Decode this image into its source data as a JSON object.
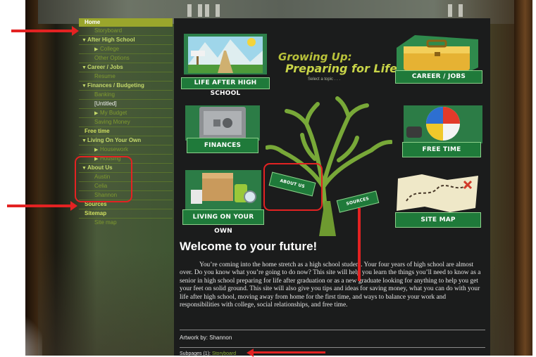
{
  "sidebar": {
    "items": [
      {
        "label": "Home"
      },
      {
        "label": "Storyboard"
      },
      {
        "label": "After High School"
      },
      {
        "label": "College"
      },
      {
        "label": "Other Options"
      },
      {
        "label": "Career / Jobs"
      },
      {
        "label": "Resume"
      },
      {
        "label": "Finances / Budgeting"
      },
      {
        "label": "Banking"
      },
      {
        "label": "[Untitled]"
      },
      {
        "label": "My Budget"
      },
      {
        "label": "Saving Money"
      },
      {
        "label": "Free time"
      },
      {
        "label": "Living On Your Own"
      },
      {
        "label": "Housework"
      },
      {
        "label": "Housing"
      },
      {
        "label": "About Us"
      },
      {
        "label": "Austin"
      },
      {
        "label": "Celia"
      },
      {
        "label": "Shannon"
      },
      {
        "label": "Sources"
      },
      {
        "label": "Sitemap"
      },
      {
        "label": "Site map"
      }
    ]
  },
  "main": {
    "title_line1": "Growing Up:",
    "title_line2": "Preparing for Life",
    "title_line3": "Select a topic . . .",
    "tiles": {
      "life_after": "LIFE AFTER HIGH SCHOOL",
      "career": "CAREER / JOBS",
      "finances": "FINANCES",
      "free_time": "FREE TIME",
      "living": "LIVING ON YOUR OWN",
      "site_map": "SITE MAP",
      "about_us": "ABOUT US",
      "sources": "SOURCES"
    },
    "welcome": "Welcome to your future!",
    "body": "You’re coming into the home stretch as a high school student. Your four years of high school are almost over. Do you know what you’re going to do now? This site will help you learn the things you’ll need to know as a senior in high school preparing for life after graduation or as a new graduate looking for anything to help you get your feet on solid ground. This site will also give you tips and ideas for saving money, what you can do with your life after high school, moving away from home for the first time, and ways to balance your work and responsibilities with college, social relationships, and free time.",
    "artwork": "Artwork by: Shannon",
    "subpages_label": "Subpages (1):",
    "subpages_link": "Storyboard"
  },
  "colors": {
    "accent_green": "#1f7a3a",
    "nav_green": "#a8c53a",
    "annotation_red": "#e32222",
    "panel_bg": "#1b1c1c"
  }
}
